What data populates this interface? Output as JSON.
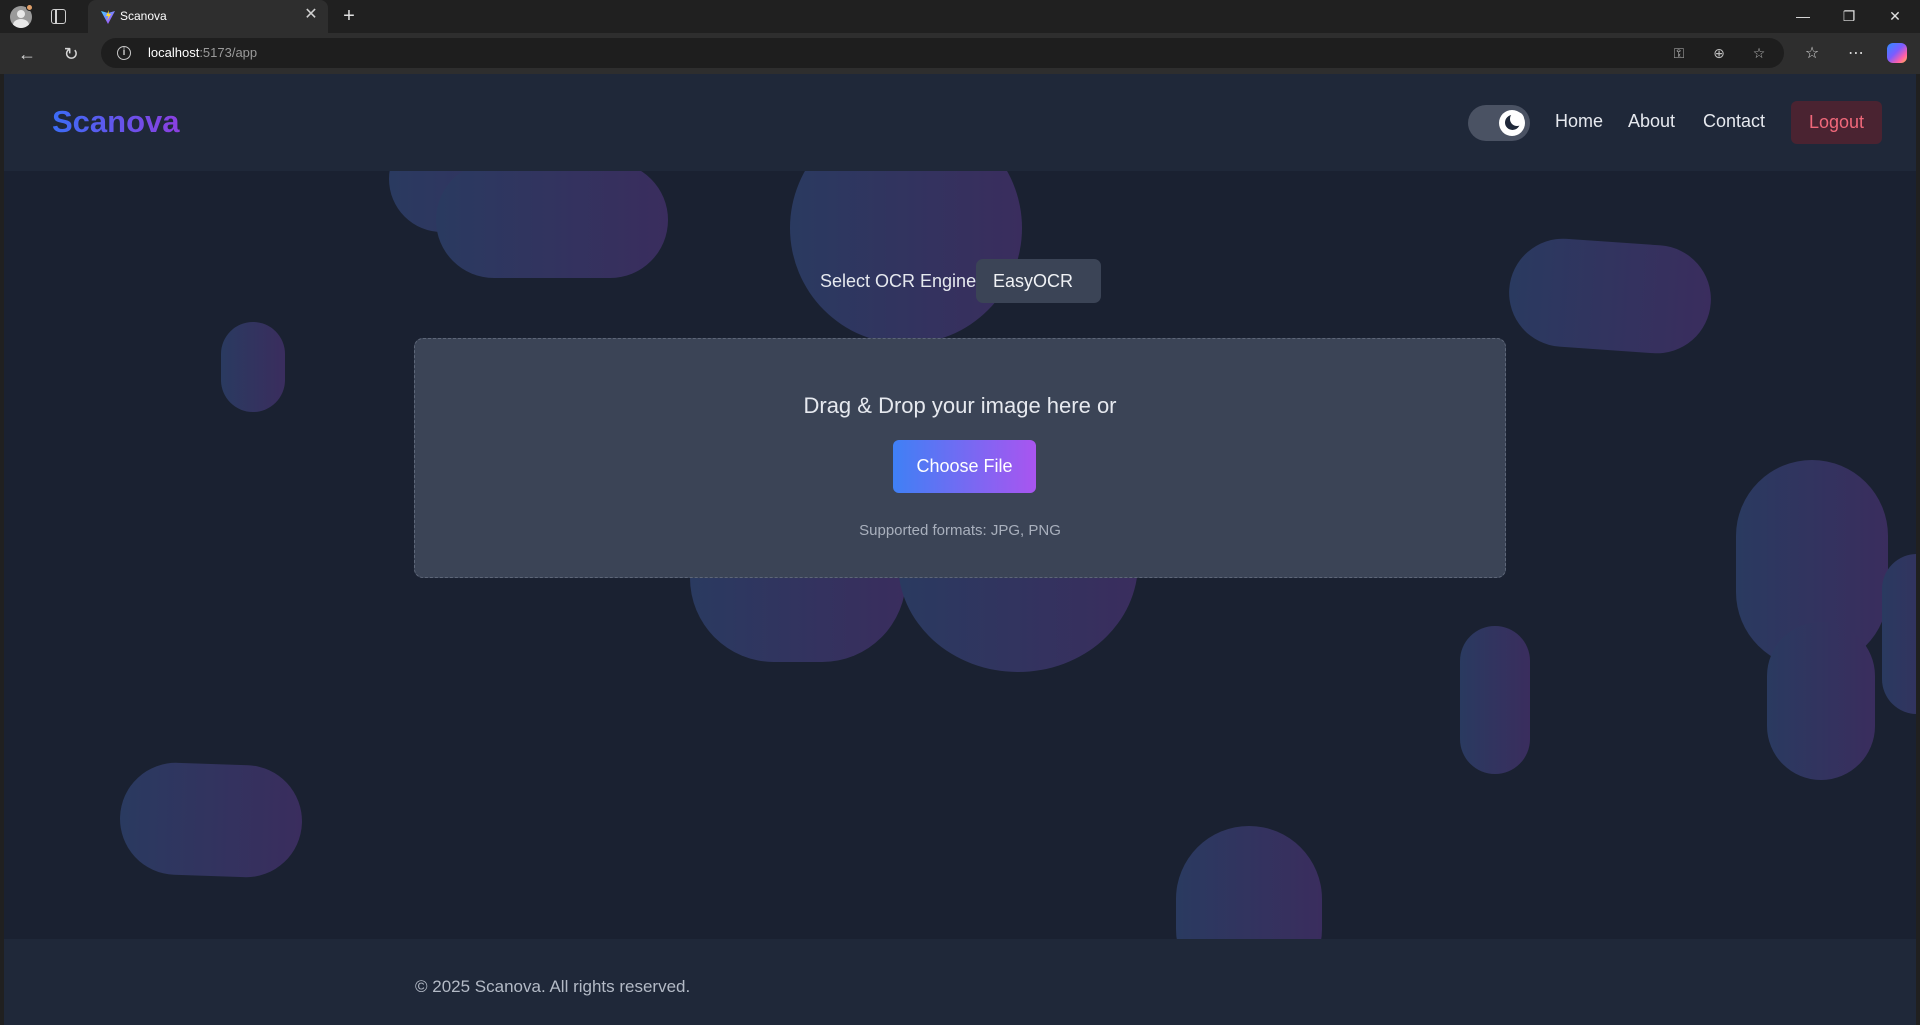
{
  "browser": {
    "tab_title": "Scanova",
    "url_host": "localhost",
    "url_rest": ":5173/app",
    "icons": [
      "profile-icon",
      "tab-actions-icon",
      "close-tab-icon",
      "new-tab-icon",
      "minimize-icon",
      "maximize-icon",
      "close-window-icon",
      "back-icon",
      "refresh-icon",
      "site-info-icon",
      "key-icon",
      "zoom-icon",
      "favorite-star-icon",
      "favorites-icon",
      "more-icon",
      "copilot-icon"
    ]
  },
  "header": {
    "logo": "Scanova",
    "nav": {
      "home": "Home",
      "about": "About",
      "contact": "Contact",
      "logout": "Logout"
    },
    "theme": "dark"
  },
  "main": {
    "engine_label": "Select OCR Engine:",
    "engine_value": "EasyOCR",
    "dropzone_text": "Drag & Drop your image here or",
    "choose_file": "Choose File",
    "formats": "Supported formats: JPG, PNG"
  },
  "footer": {
    "copyright": "© 2025 Scanova. All rights reserved."
  },
  "colors": {
    "page_bg": "#1a2131",
    "header_bg": "#1f2839",
    "panel_bg": "#3b4456",
    "logout_text": "#f0687a",
    "button_gradient_start": "#3f80f5",
    "button_gradient_end": "#a955f0"
  }
}
